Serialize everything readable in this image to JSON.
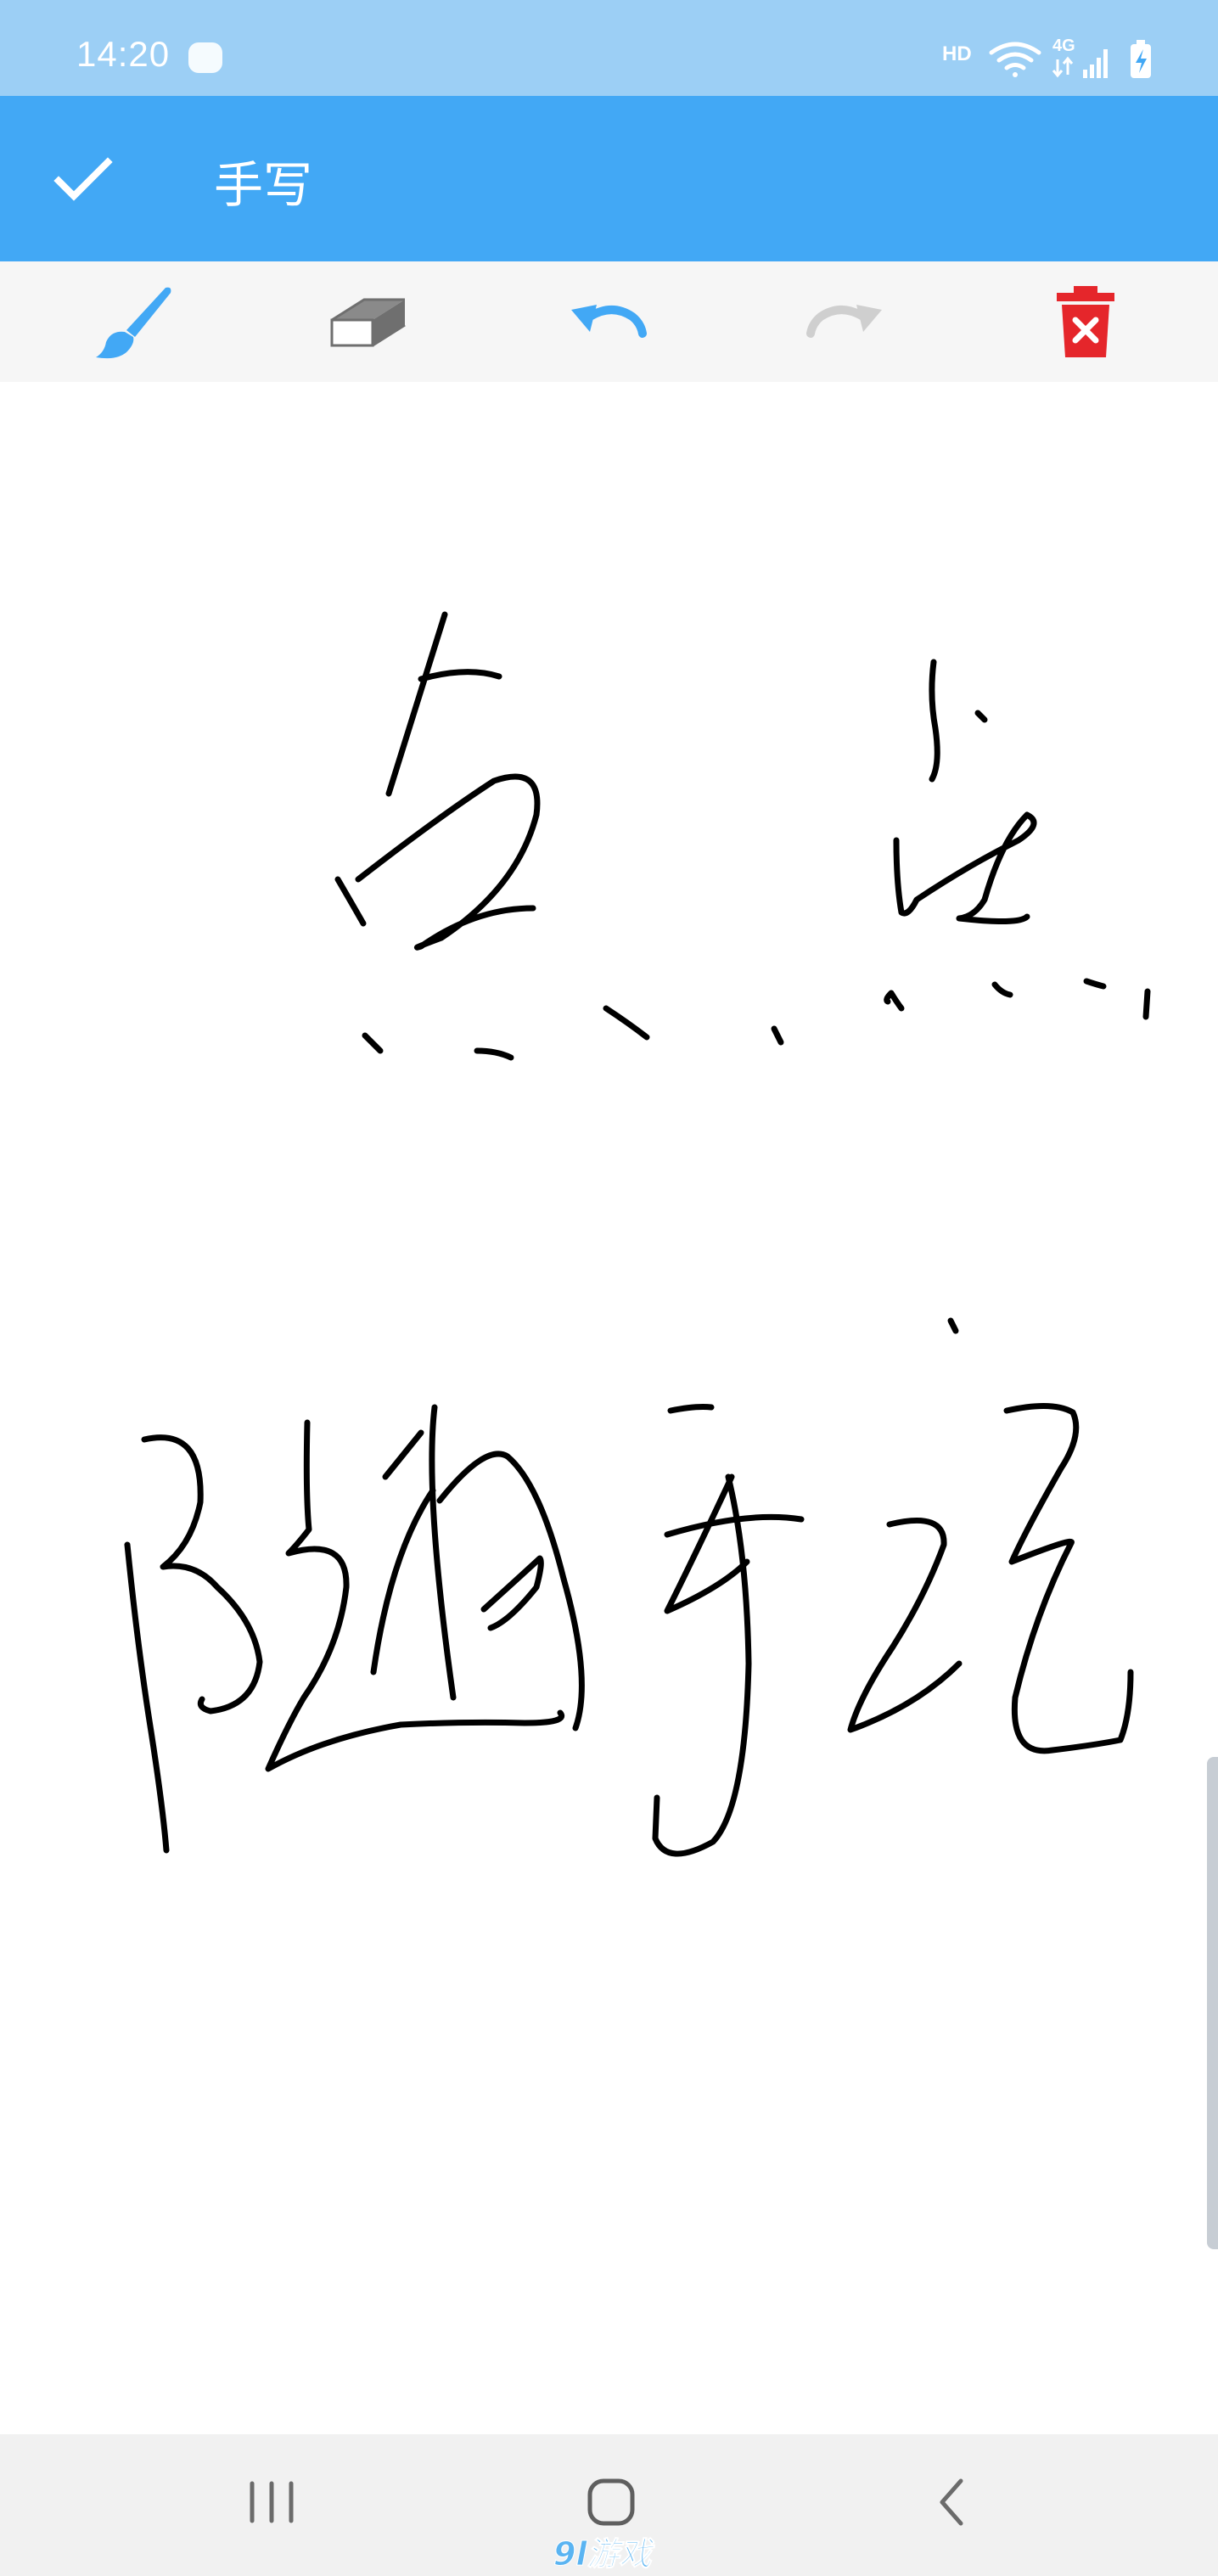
{
  "status_bar": {
    "time": "14:20",
    "network_label": "HD",
    "network_type": "4G",
    "icons": [
      "dex-icon",
      "hd-icon",
      "wifi-icon",
      "4g-icon",
      "signal-icon",
      "battery-charging-icon"
    ]
  },
  "app_bar": {
    "title": "手写",
    "confirm_icon": "check-icon",
    "color": "#42a8f5"
  },
  "toolbar": {
    "tools": [
      {
        "name": "brush",
        "icon": "brush-icon",
        "color": "#42a8f5",
        "state": "selected"
      },
      {
        "name": "eraser",
        "icon": "eraser-icon",
        "color": "#9e9e9e",
        "state": "idle"
      },
      {
        "name": "undo",
        "icon": "undo-icon",
        "color": "#42a8f5",
        "state": "enabled"
      },
      {
        "name": "redo",
        "icon": "redo-icon",
        "color": "#cfcfcf",
        "state": "disabled"
      },
      {
        "name": "clear",
        "icon": "trash-icon",
        "color": "#e5262b",
        "state": "enabled"
      }
    ]
  },
  "canvas": {
    "ink_color": "#000000",
    "strokes": "handwritten ink"
  },
  "nav_bar": {
    "buttons": [
      "recent-apps-icon",
      "home-icon",
      "back-icon"
    ]
  },
  "colors": {
    "status_bar": "#9ccff5",
    "app_bar": "#42a8f5",
    "toolbar_bg": "#f6f6f6",
    "nav_bg": "#f1f1f1"
  }
}
